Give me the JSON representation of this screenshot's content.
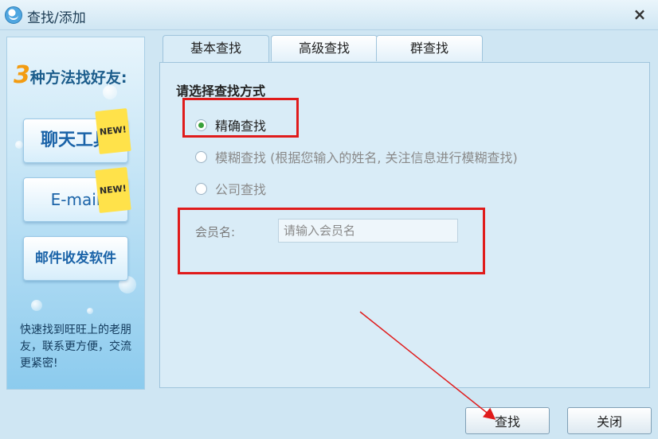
{
  "window": {
    "title": "查找/添加",
    "close_label": "×"
  },
  "promo": {
    "headline_num": "3",
    "headline_text": "种方法找好友:",
    "tiles": [
      {
        "label": "聊天工具",
        "badge": "NEW!"
      },
      {
        "label": "E-mail",
        "badge": "NEW!"
      },
      {
        "label": "邮件收发软件"
      }
    ],
    "footer": "快速找到旺旺上的老朋友，联系更方便，交流更紧密!"
  },
  "tabs": [
    {
      "label": "基本查找",
      "active": true
    },
    {
      "label": "高级查找",
      "active": false
    },
    {
      "label": "群查找",
      "active": false
    }
  ],
  "search": {
    "section_title": "请选择查找方式",
    "options": [
      {
        "label": "精确查找",
        "checked": true,
        "enabled": true
      },
      {
        "label": "模糊查找 (根据您输入的姓名, 关注信息进行模糊查找)",
        "checked": false,
        "enabled": false
      },
      {
        "label": "公司查找",
        "checked": false,
        "enabled": false
      }
    ],
    "member_label": "会员名:",
    "member_placeholder": "请输入会员名",
    "member_value": ""
  },
  "buttons": {
    "search": "查找",
    "close": "关闭"
  },
  "colors": {
    "highlight": "#e01b1b",
    "background": "#cfe6f3",
    "accent": "#1a63a8"
  }
}
